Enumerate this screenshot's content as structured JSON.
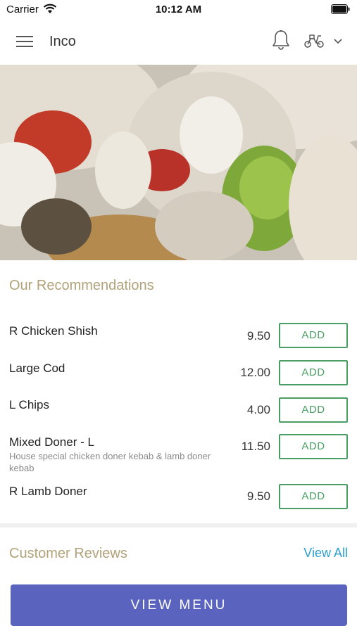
{
  "status_bar": {
    "carrier": "Carrier",
    "time": "10:12 AM"
  },
  "header": {
    "title": "Inco",
    "icons": [
      "menu-icon",
      "bell-icon",
      "scooter-icon",
      "chevron-down-icon"
    ]
  },
  "hero": {
    "image": "food-wrap-photo"
  },
  "recommendations": {
    "title": "Our Recommendations",
    "add_label": "ADD",
    "items": [
      {
        "name": "R Chicken Shish",
        "price": "9.50",
        "description": ""
      },
      {
        "name": "Large Cod",
        "price": "12.00",
        "description": ""
      },
      {
        "name": "L Chips",
        "price": "4.00",
        "description": ""
      },
      {
        "name": "Mixed Doner - L",
        "price": "11.50",
        "description": "House special chicken doner kebab & lamb doner kebab"
      },
      {
        "name": "R Lamb Doner",
        "price": "9.50",
        "description": ""
      }
    ]
  },
  "reviews": {
    "title": "Customer Reviews",
    "view_all": "View All"
  },
  "footer": {
    "view_menu": "VIEW MENU"
  },
  "colors": {
    "accent_gold": "#b1a27a",
    "add_green": "#4a9e64",
    "link_blue": "#2b9ed0",
    "button_indigo": "#5a63bd"
  }
}
